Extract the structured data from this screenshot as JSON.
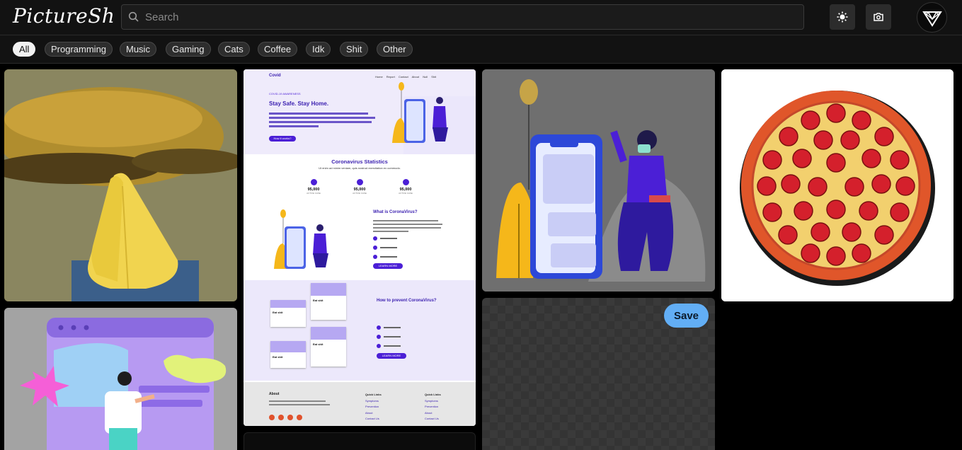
{
  "app": {
    "logo": "PictureSh"
  },
  "search": {
    "placeholder": "Search",
    "value": ""
  },
  "header": {
    "theme_icon": "sun-icon",
    "upload_icon": "camera-icon",
    "avatar_icon": "geometric-logo"
  },
  "categories": [
    "All",
    "Programming",
    "Music",
    "Gaming",
    "Cats",
    "Coffee",
    "Idk",
    "Shit",
    "Other"
  ],
  "active_category": "All",
  "save_label": "Save",
  "webpage_preview": {
    "brand": "Covid",
    "nav": [
      "Home",
      "Report",
      "Contact",
      "About",
      "Null",
      "Shit"
    ],
    "kicker": "COVID-19 AWARENESS",
    "hero_title": "Stay Safe. Stay Home.",
    "hero_btn": "How it works?",
    "stats_title": "Coronavirus Statistics",
    "stats_sub": "Ut enim ad minim veniam, quis nostrud exercitation ex commodo.",
    "stats": [
      "95,000",
      "95,000",
      "95,000"
    ],
    "stat_caption": "ACTIVE CASE",
    "what_title": "What is CoronaVirus?",
    "learn_more": "LEARN MORE",
    "prevent_title": "How to prevent CoronaVirus?",
    "card_title": "Eat shit",
    "footer_about": "About",
    "footer_links": "Quick Links",
    "footer_items": [
      "Symptoms",
      "Prevention",
      "About",
      "Contact Us"
    ]
  },
  "colors": {
    "accent": "#62aef5",
    "purple": "#4b1fd6",
    "bg": "#000000",
    "header": "#121212"
  }
}
